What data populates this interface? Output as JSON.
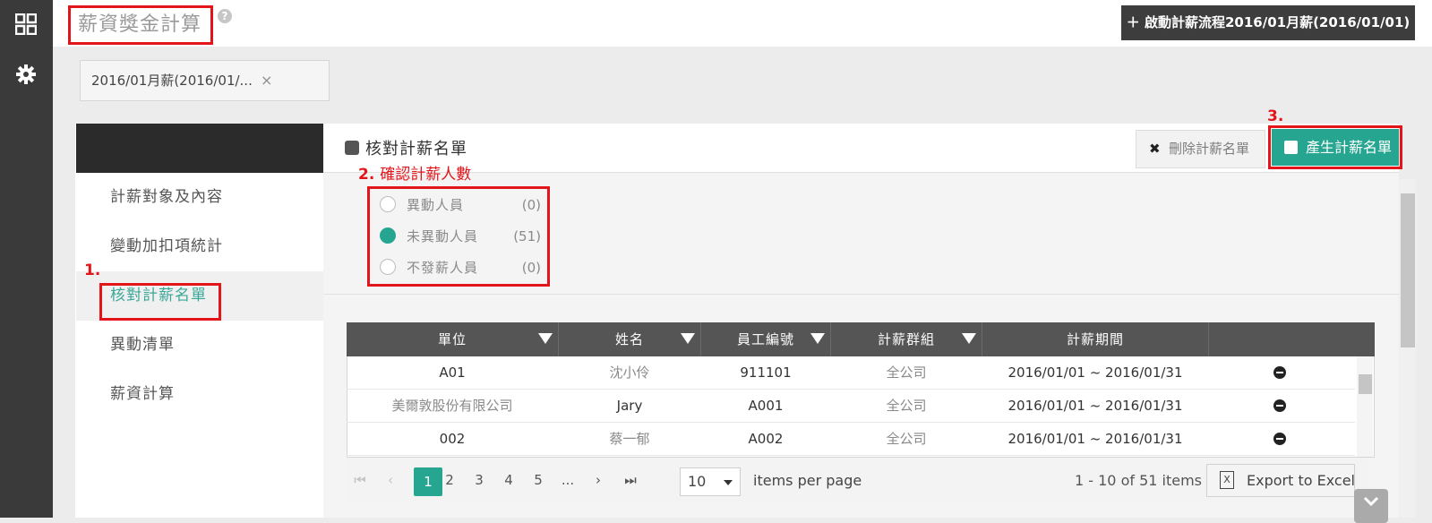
{
  "header": {
    "title": "薪資獎金計算",
    "help": "?",
    "start_button": "＋  啟動計薪流程2016/01月薪(2016/01/01)"
  },
  "tabs": [
    {
      "label": "2016/01月薪(2016/01/...",
      "close": "×"
    }
  ],
  "sidebar": {
    "items": [
      {
        "label": "計薪對象及內容"
      },
      {
        "label": "變動加扣項統計"
      },
      {
        "label": "核對計薪名單"
      },
      {
        "label": "異動清單"
      },
      {
        "label": "薪資計算"
      }
    ],
    "active_index": 2
  },
  "annotations": {
    "step1": "1.",
    "step2": "2.",
    "step2_text": "確認計薪人數",
    "step3": "3."
  },
  "main": {
    "title": "核對計薪名單",
    "delete_button": "刪除計薪名單",
    "delete_icon": "✖",
    "generate_button": "產生計薪名單"
  },
  "filters": [
    {
      "label": "異動人員",
      "count": "(0)",
      "checked": false
    },
    {
      "label": "未異動人員",
      "count": "(51)",
      "checked": true
    },
    {
      "label": "不發薪人員",
      "count": "(0)",
      "checked": false
    }
  ],
  "grid": {
    "columns": [
      "單位",
      "姓名",
      "員工編號",
      "計薪群組",
      "計薪期間",
      ""
    ],
    "rows": [
      {
        "unit": "A01",
        "name": "沈小伶",
        "id": "911101",
        "group": "全公司",
        "period": "2016/01/01 ~ 2016/01/31"
      },
      {
        "unit": "美爾敦股份有限公司",
        "name": "Jary",
        "id": "A001",
        "group": "全公司",
        "period": "2016/01/01 ~ 2016/01/31"
      },
      {
        "unit": "002",
        "name": "蔡一郁",
        "id": "A002",
        "group": "全公司",
        "period": "2016/01/01 ~ 2016/01/31"
      }
    ]
  },
  "pager": {
    "first": "⏮",
    "prev": "‹",
    "pages": [
      "1",
      "2",
      "3",
      "4",
      "5",
      "..."
    ],
    "next": "›",
    "last": "⏭",
    "page_size": "10",
    "items_per_page": "items per page",
    "summary": "1 - 10 of 51 items",
    "export": "Export to Excel",
    "export_icon": "X"
  },
  "colors": {
    "accent": "#26a691",
    "annotation": "#e3151b",
    "header_dark": "#3d3d3d"
  },
  "icons": {
    "rail_top": "grid-icon",
    "rail_settings": "gear-icon"
  }
}
